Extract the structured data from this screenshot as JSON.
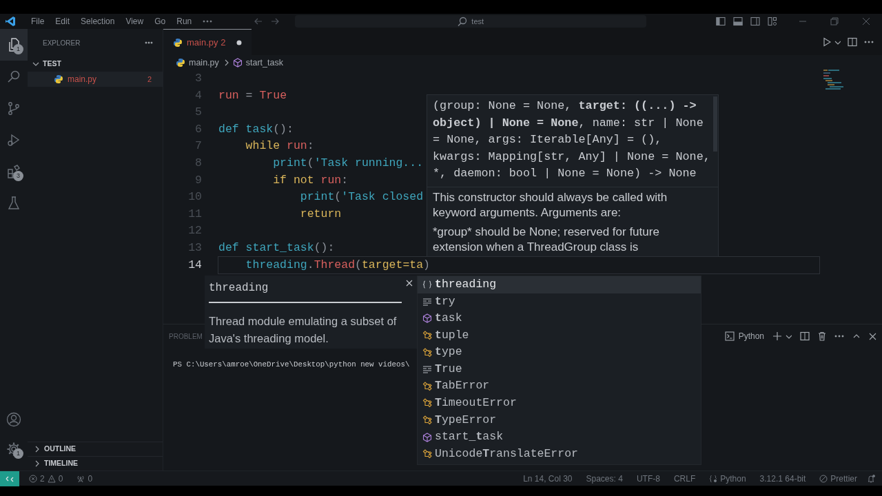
{
  "title_bar": {
    "menus": [
      "File",
      "Edit",
      "Selection",
      "View",
      "Go",
      "Run"
    ],
    "search": "test"
  },
  "activity_bar": [
    {
      "kind": "explorer",
      "selected": true,
      "badge": "1"
    },
    {
      "kind": "search",
      "selected": false
    },
    {
      "kind": "source-control",
      "selected": false
    },
    {
      "kind": "run",
      "selected": false
    },
    {
      "kind": "extensions",
      "selected": false,
      "badge": "3"
    },
    {
      "kind": "testing",
      "selected": false
    },
    {
      "kind": "account",
      "selected": false
    },
    {
      "kind": "settings",
      "selected": false,
      "badge": "1"
    }
  ],
  "sidebar": {
    "title": "EXPLORER",
    "folder": {
      "name": "TEST",
      "expanded": true,
      "files": [
        {
          "name": "main.py",
          "problems": "2",
          "selected": true
        }
      ]
    },
    "sections": [
      {
        "name": "OUTLINE",
        "expanded": false
      },
      {
        "name": "TIMELINE",
        "expanded": false
      }
    ]
  },
  "editor": {
    "tabs": [
      {
        "name": "main.py",
        "problems": "2",
        "modified": true,
        "selected": true
      }
    ],
    "breadcrumb": [
      "main.py",
      "start_task"
    ],
    "lines": [
      {
        "number": "3",
        "current": false
      },
      {
        "number": "4",
        "current": false,
        "tokens": [
          {
            "kind": "var",
            "t": "run"
          },
          {
            "kind": "op",
            "t": " = "
          },
          {
            "kind": "const",
            "t": "True"
          }
        ]
      },
      {
        "number": "5",
        "current": false
      },
      {
        "number": "6",
        "current": false,
        "tokens": [
          {
            "kind": "def",
            "t": "def "
          },
          {
            "kind": "fn",
            "t": "task"
          },
          {
            "kind": "op",
            "t": "():"
          }
        ]
      },
      {
        "number": "7",
        "current": false,
        "tokens": [
          {
            "kind": "kw",
            "t": "    while "
          },
          {
            "kind": "var",
            "t": "run"
          },
          {
            "kind": "op",
            "t": ":"
          }
        ]
      },
      {
        "number": "8",
        "current": false,
        "tokens": [
          {
            "kind": "fn",
            "t": "        print"
          },
          {
            "kind": "op",
            "t": "("
          },
          {
            "kind": "str",
            "t": "'Task running..."
          }
        ]
      },
      {
        "number": "9",
        "current": false,
        "tokens": [
          {
            "kind": "kw",
            "t": "        if not "
          },
          {
            "kind": "var",
            "t": "run"
          },
          {
            "kind": "op",
            "t": ":"
          }
        ]
      },
      {
        "number": "10",
        "current": false,
        "tokens": [
          {
            "kind": "fn",
            "t": "            print"
          },
          {
            "kind": "op",
            "t": "("
          },
          {
            "kind": "str",
            "t": "'Task closed"
          }
        ]
      },
      {
        "number": "11",
        "current": false,
        "tokens": [
          {
            "kind": "kw",
            "t": "            return"
          }
        ]
      },
      {
        "number": "12",
        "current": false
      },
      {
        "number": "13",
        "current": false,
        "tokens": [
          {
            "kind": "def",
            "t": "def "
          },
          {
            "kind": "fn",
            "t": "start_task"
          },
          {
            "kind": "op",
            "t": "():"
          }
        ]
      },
      {
        "number": "14",
        "current": true,
        "tokens": [
          {
            "kind": "mod",
            "t": "    threading"
          },
          {
            "kind": "op",
            "t": "."
          },
          {
            "kind": "cls",
            "t": "Thread"
          },
          {
            "kind": "op",
            "t": "("
          },
          {
            "kind": "param",
            "t": "target=ta"
          },
          {
            "kind": "op",
            "t": ")"
          }
        ]
      }
    ],
    "hover": {
      "signature": "(group: None = None, **target: ((...) -> object) | None = None**, name: str | None = None, args: Iterable[Any] = (), kwargs: Mapping[str, Any] | None = None, *, daemon: bool | None = None) -> None",
      "doc": [
        "This constructor should always be called with keyword arguments. Arguments are:",
        "*group* should be None; reserved for future extension when a ThreadGroup class is"
      ]
    },
    "suggest": {
      "detail_title": "threading",
      "detail_doc": "Thread module emulating a subset of Java's threading model.",
      "items": [
        {
          "kind": "module",
          "label": "**t**hreading",
          "selected": true
        },
        {
          "kind": "keyword",
          "label": "**t**ry",
          "selected": false
        },
        {
          "kind": "function",
          "label": "**t**ask",
          "selected": false
        },
        {
          "kind": "class",
          "label": "**t**uple",
          "selected": false
        },
        {
          "kind": "class",
          "label": "**t**ype",
          "selected": false
        },
        {
          "kind": "keyword",
          "label": "**T**rue",
          "selected": false
        },
        {
          "kind": "class",
          "label": "**T**abError",
          "selected": false
        },
        {
          "kind": "class",
          "label": "**T**imeoutError",
          "selected": false
        },
        {
          "kind": "class",
          "label": "**T**ypeError",
          "selected": false
        },
        {
          "kind": "function",
          "label": "start_**t**ask",
          "selected": false
        },
        {
          "kind": "class",
          "label": "Unicode**T**ranslateError",
          "selected": false
        }
      ]
    }
  },
  "panel": {
    "tab": "PROBLEM",
    "terminal_line": "PS C:\\Users\\amroe\\OneDrive\\Desktop\\python new videos\\",
    "terminal_name": "Python"
  },
  "status_bar": {
    "errors": "2",
    "warnings": "0",
    "ports": "0",
    "items": [
      {
        "kind": "text",
        "text": "Ln 14, Col 30"
      },
      {
        "kind": "text",
        "text": "Spaces: 4"
      },
      {
        "kind": "text",
        "text": "UTF-8"
      },
      {
        "kind": "text",
        "text": "CRLF"
      },
      {
        "kind": "language",
        "text": "Python"
      },
      {
        "kind": "text",
        "text": "3.12.1 64-bit"
      },
      {
        "kind": "formatter",
        "text": "Prettier"
      },
      {
        "kind": "bell"
      }
    ]
  }
}
